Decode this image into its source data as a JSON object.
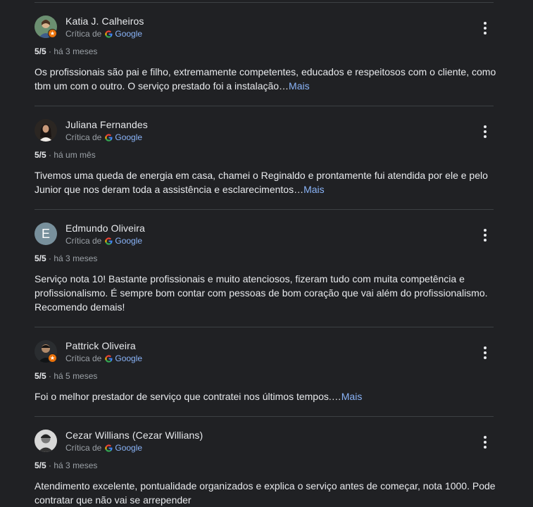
{
  "labels": {
    "critic_of": "Crítica de",
    "google": "Google",
    "more": "Mais",
    "dot": "·"
  },
  "reviews": [
    {
      "name": "Katia J. Calheiros",
      "rating": "5/5",
      "time": "há 3 meses",
      "text": "Os profissionais são pai e filho, extremamente competentes, educados e respeitosos com o cliente, como tbm um com o outro. O serviço prestado foi a instalação…",
      "has_more": true,
      "avatar_icon": "profile-photo",
      "local_guide": true
    },
    {
      "name": "Juliana Fernandes",
      "rating": "5/5",
      "time": "há um mês",
      "text": "Tivemos uma queda de energia em casa, chamei o Reginaldo e prontamente fui atendida por ele e pelo Junior que nos deram toda a assistência e esclarecimentos…",
      "has_more": true,
      "avatar_icon": "profile-photo",
      "local_guide": false
    },
    {
      "name": "Edmundo Oliveira",
      "rating": "5/5",
      "time": "há 3 meses",
      "text": "Serviço nota 10! Bastante profissionais e muito atenciosos, fizeram tudo com muita competência e profissionalismo. É sempre bom contar com pessoas de bom coração que vai além do profissionalismo. Recomendo demais!",
      "has_more": false,
      "avatar_letter": "E",
      "avatar_color": "#78909c",
      "local_guide": false
    },
    {
      "name": "Pattrick Oliveira",
      "rating": "5/5",
      "time": "há 5 meses",
      "text": "Foi o melhor prestador de serviço que contratei nos últimos tempos.…",
      "has_more": true,
      "avatar_icon": "profile-photo",
      "local_guide": true
    },
    {
      "name": "Cezar Willians (Cezar Willians)",
      "rating": "5/5",
      "time": "há 3 meses",
      "text": "Atendimento excelente, pontualidade organizados e explica o serviço antes de começar, nota 1000. Pode contratar que não vai se arrepender",
      "has_more": false,
      "avatar_icon": "profile-photo",
      "local_guide": false
    }
  ],
  "colors": {
    "background": "#202124",
    "link": "#8ab4f8",
    "local_guide_badge": "#e8710a"
  }
}
